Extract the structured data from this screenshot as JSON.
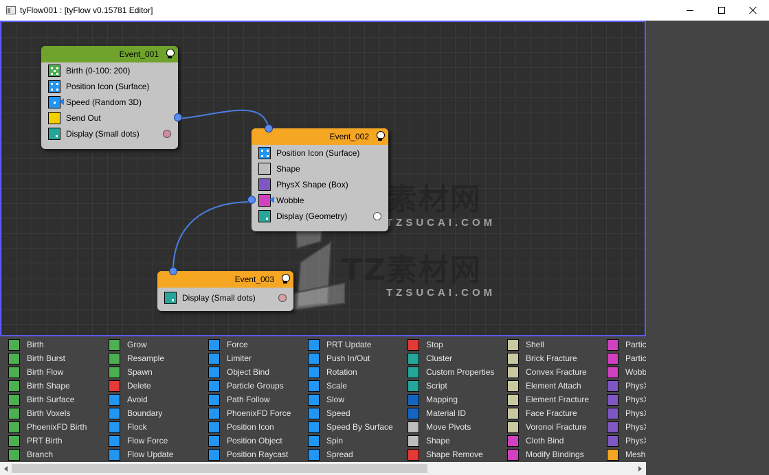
{
  "window": {
    "title": "tyFlow001 : [tyFlow v0.15781 Editor]",
    "icons": [
      "minimize-icon",
      "maximize-icon",
      "close-icon"
    ]
  },
  "colors": {
    "graph_bg": "#2f2f2f",
    "graph_border": "#5a5aff",
    "event_green": "#6fa32c",
    "event_orange": "#f5a623",
    "wire": "#4a7fe0",
    "node_body": "#c4c4c4"
  },
  "events": [
    {
      "name": "Event_001",
      "header_color": "#6fa32c",
      "operators": [
        {
          "label": "Birth (0-100: 200)",
          "icon": "birth-icon",
          "color": "#4caf50"
        },
        {
          "label": "Position Icon (Surface)",
          "icon": "position-icon",
          "color": "#2196f3"
        },
        {
          "label": "Speed (Random 3D)",
          "icon": "speed-icon",
          "color": "#2196f3"
        },
        {
          "label": "Send Out",
          "icon": "send-out-icon",
          "color": "#f5d000"
        },
        {
          "label": "Display (Small dots)",
          "icon": "display-icon",
          "color": "#26a69a"
        }
      ]
    },
    {
      "name": "Event_002",
      "header_color": "#f5a623",
      "operators": [
        {
          "label": "Position Icon (Surface)",
          "icon": "position-icon",
          "color": "#2196f3"
        },
        {
          "label": "Shape",
          "icon": "shape-icon",
          "color": "#bdbdbd"
        },
        {
          "label": "PhysX Shape (Box)",
          "icon": "physx-icon",
          "color": "#7e57c2"
        },
        {
          "label": "Wobble",
          "icon": "wobble-icon",
          "color": "#d040c0"
        },
        {
          "label": "Display (Geometry)",
          "icon": "display-icon",
          "color": "#26a69a"
        }
      ]
    },
    {
      "name": "Event_003",
      "header_color": "#f5a623",
      "operators": [
        {
          "label": "Display (Small dots)",
          "icon": "display-icon",
          "color": "#26a69a"
        }
      ]
    }
  ],
  "watermark": {
    "text": "TZ素材网",
    "sub": "TZSUCAI.COM"
  },
  "library": [
    [
      {
        "label": "Birth",
        "color": "#4caf50"
      },
      {
        "label": "Birth Burst",
        "color": "#4caf50"
      },
      {
        "label": "Birth Flow",
        "color": "#4caf50"
      },
      {
        "label": "Birth Shape",
        "color": "#4caf50"
      },
      {
        "label": "Birth Surface",
        "color": "#4caf50"
      },
      {
        "label": "Birth Voxels",
        "color": "#4caf50"
      },
      {
        "label": "PhoenixFD Birth",
        "color": "#4caf50"
      },
      {
        "label": "PRT Birth",
        "color": "#4caf50"
      },
      {
        "label": "Branch",
        "color": "#4caf50"
      }
    ],
    [
      {
        "label": "Grow",
        "color": "#4caf50"
      },
      {
        "label": "Resample",
        "color": "#4caf50"
      },
      {
        "label": "Spawn",
        "color": "#4caf50"
      },
      {
        "label": "Delete",
        "color": "#e53935"
      },
      {
        "label": "Avoid",
        "color": "#2196f3"
      },
      {
        "label": "Boundary",
        "color": "#2196f3"
      },
      {
        "label": "Flock",
        "color": "#2196f3"
      },
      {
        "label": "Flow Force",
        "color": "#2196f3"
      },
      {
        "label": "Flow Update",
        "color": "#2196f3"
      }
    ],
    [
      {
        "label": "Force",
        "color": "#2196f3"
      },
      {
        "label": "Limiter",
        "color": "#2196f3"
      },
      {
        "label": "Object Bind",
        "color": "#2196f3"
      },
      {
        "label": "Particle Groups",
        "color": "#2196f3"
      },
      {
        "label": "Path Follow",
        "color": "#2196f3"
      },
      {
        "label": "PhoenixFD Force",
        "color": "#2196f3"
      },
      {
        "label": "Position Icon",
        "color": "#2196f3"
      },
      {
        "label": "Position Object",
        "color": "#2196f3"
      },
      {
        "label": "Position Raycast",
        "color": "#2196f3"
      }
    ],
    [
      {
        "label": "PRT Update",
        "color": "#2196f3"
      },
      {
        "label": "Push In/Out",
        "color": "#2196f3"
      },
      {
        "label": "Rotation",
        "color": "#2196f3"
      },
      {
        "label": "Scale",
        "color": "#2196f3"
      },
      {
        "label": "Slow",
        "color": "#2196f3"
      },
      {
        "label": "Speed",
        "color": "#2196f3"
      },
      {
        "label": "Speed By Surface",
        "color": "#2196f3"
      },
      {
        "label": "Spin",
        "color": "#2196f3"
      },
      {
        "label": "Spread",
        "color": "#2196f3"
      }
    ],
    [
      {
        "label": "Stop",
        "color": "#e53935"
      },
      {
        "label": "Cluster",
        "color": "#26a69a"
      },
      {
        "label": "Custom Properties",
        "color": "#26a69a"
      },
      {
        "label": "Script",
        "color": "#26a69a"
      },
      {
        "label": "Mapping",
        "color": "#1565c0"
      },
      {
        "label": "Material ID",
        "color": "#1565c0"
      },
      {
        "label": "Move Pivots",
        "color": "#bdbdbd"
      },
      {
        "label": "Shape",
        "color": "#bdbdbd"
      },
      {
        "label": "Shape Remove",
        "color": "#e53935"
      }
    ],
    [
      {
        "label": "Shell",
        "color": "#c9c9a0"
      },
      {
        "label": "Brick Fracture",
        "color": "#c9c9a0"
      },
      {
        "label": "Convex Fracture",
        "color": "#c9c9a0"
      },
      {
        "label": "Element Attach",
        "color": "#c9c9a0"
      },
      {
        "label": "Element Fracture",
        "color": "#c9c9a0"
      },
      {
        "label": "Face Fracture",
        "color": "#c9c9a0"
      },
      {
        "label": "Voronoi Fracture",
        "color": "#c9c9a0"
      },
      {
        "label": "Cloth Bind",
        "color": "#d040c0"
      },
      {
        "label": "Modify Bindings",
        "color": "#d040c0"
      }
    ],
    [
      {
        "label": "Partic",
        "color": "#d040c0"
      },
      {
        "label": "Partic",
        "color": "#d040c0"
      },
      {
        "label": "Wobb",
        "color": "#d040c0"
      },
      {
        "label": "PhysX",
        "color": "#7e57c2"
      },
      {
        "label": "PhysX",
        "color": "#7e57c2"
      },
      {
        "label": "PhysX",
        "color": "#7e57c2"
      },
      {
        "label": "PhysX",
        "color": "#7e57c2"
      },
      {
        "label": "PhysX",
        "color": "#7e57c2"
      },
      {
        "label": "Mesh",
        "color": "#f5a623"
      }
    ]
  ]
}
